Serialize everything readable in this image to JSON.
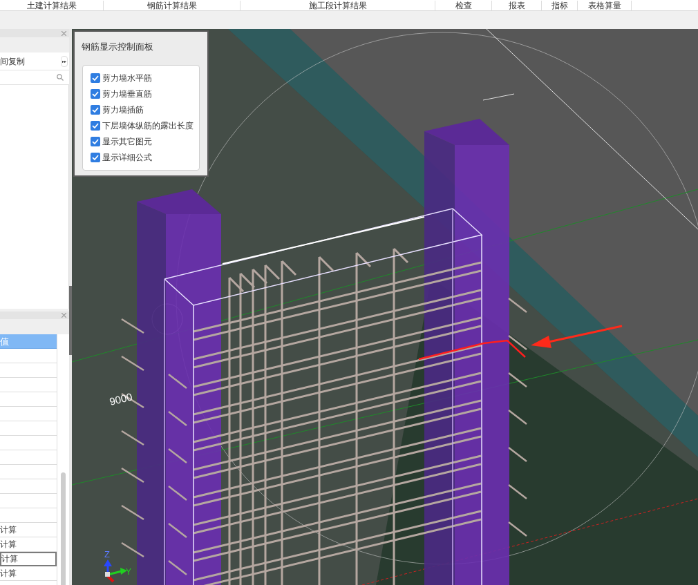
{
  "menu": [
    {
      "label": "土建计算结果"
    },
    {
      "label": "钢筋计算结果"
    },
    {
      "label": "施工段计算结果"
    },
    {
      "label": "检查"
    },
    {
      "label": "报表"
    },
    {
      "label": "指标"
    },
    {
      "label": "表格算量"
    }
  ],
  "left_panel": {
    "item": "间复制",
    "more_button": "▸▸"
  },
  "properties": {
    "header": "值",
    "rows": [
      {
        "value": "计算",
        "selected": false
      },
      {
        "value": "计算",
        "selected": false
      },
      {
        "value": "计算",
        "selected": true
      },
      {
        "value": "计算",
        "selected": false
      }
    ]
  },
  "control_panel": {
    "title": "钢筋显示控制面板",
    "options": [
      {
        "label": "剪力墙水平筋",
        "checked": true
      },
      {
        "label": "剪力墙垂直筋",
        "checked": true
      },
      {
        "label": "剪力墙插筋",
        "checked": true
      },
      {
        "label": "下层墙体纵筋的露出长度",
        "checked": true
      },
      {
        "label": "显示其它图元",
        "checked": true
      },
      {
        "label": "显示详细公式",
        "checked": true
      }
    ]
  },
  "viewport": {
    "dimension_label": "9000",
    "axes": [
      {
        "label": "Z"
      },
      {
        "label": "Y"
      }
    ]
  }
}
